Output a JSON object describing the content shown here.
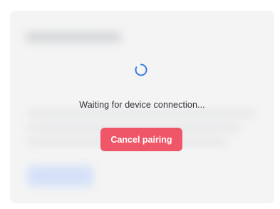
{
  "status": {
    "message": "Waiting for device connection..."
  },
  "actions": {
    "cancel_label": "Cancel pairing"
  },
  "colors": {
    "spinner": "#3b7ddd",
    "cancel_button": "#ef5667",
    "card_background": "#f4f4f5"
  },
  "icons": {
    "loading": "spinner-icon"
  }
}
